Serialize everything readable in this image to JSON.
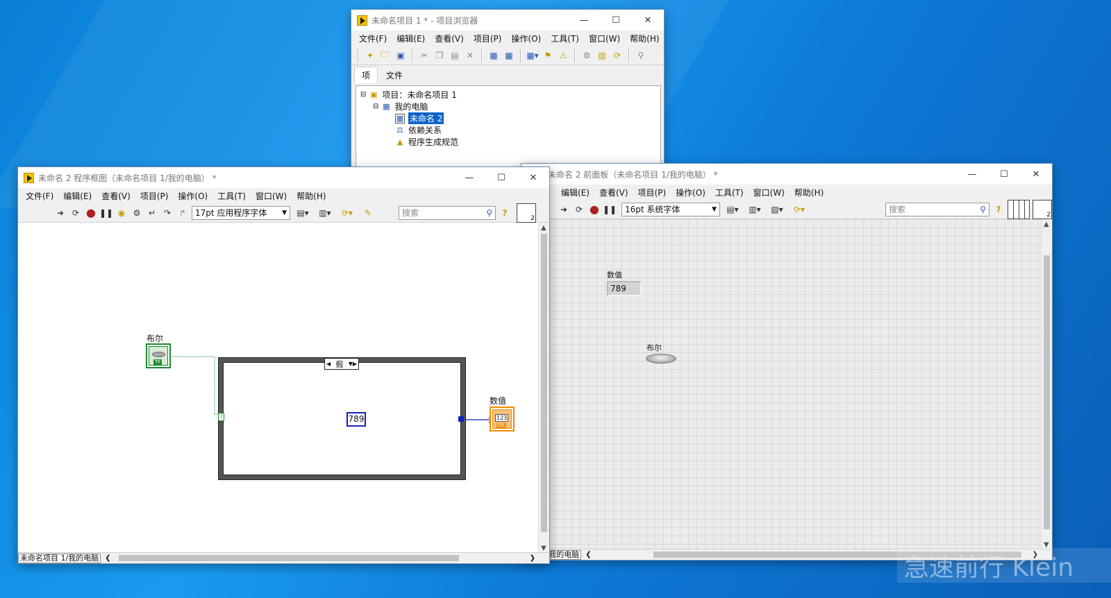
{
  "project_window": {
    "title": "未命名项目 1 * - 项目浏览器",
    "menu": [
      "文件(F)",
      "编辑(E)",
      "查看(V)",
      "项目(P)",
      "操作(O)",
      "工具(T)",
      "窗口(W)",
      "帮助(H)"
    ],
    "tabs": [
      "项",
      "文件"
    ],
    "tree": {
      "root": "项目：未命名项目 1",
      "computer": "我的电脑",
      "vi": "未命名 2",
      "deps": "依赖关系",
      "build": "程序生成规范"
    }
  },
  "block_diagram": {
    "title": "未命名 2 程序框图（未命名项目 1/我的电脑） *",
    "menu": [
      "文件(F)",
      "编辑(E)",
      "查看(V)",
      "项目(P)",
      "操作(O)",
      "工具(T)",
      "窗口(W)",
      "帮助(H)"
    ],
    "font": "17pt 应用程序字体",
    "search_placeholder": "搜索",
    "bool_label": "布尔",
    "bool_terminal": "TF",
    "case_selector": "假",
    "selector_terminal": "?",
    "constant": "789",
    "num_label": "数值",
    "num_terminal": "123",
    "num_type": "DBL",
    "status_path": "未命名项目 1/我的电脑"
  },
  "front_panel": {
    "title": "未命名 2 前面板（未命名项目 1/我的电脑） *",
    "menu": [
      "编辑(E)",
      "查看(V)",
      "项目(P)",
      "操作(O)",
      "工具(T)",
      "窗口(W)",
      "帮助(H)"
    ],
    "font": "16pt 系统字体",
    "search_placeholder": "搜索",
    "num_label": "数值",
    "num_value": "789",
    "bool_label": "布尔",
    "status_path": "项目 1/我的电脑"
  },
  "watermark": "急速前行 Klein",
  "connector_pane_number": "2",
  "colors": {
    "desktop": "#1a8fe6",
    "wire_bool": "#0a8a2a",
    "wire_num": "#1020c0",
    "num_terminal": "#f08a00",
    "bool_terminal": "#1a8a2a"
  }
}
